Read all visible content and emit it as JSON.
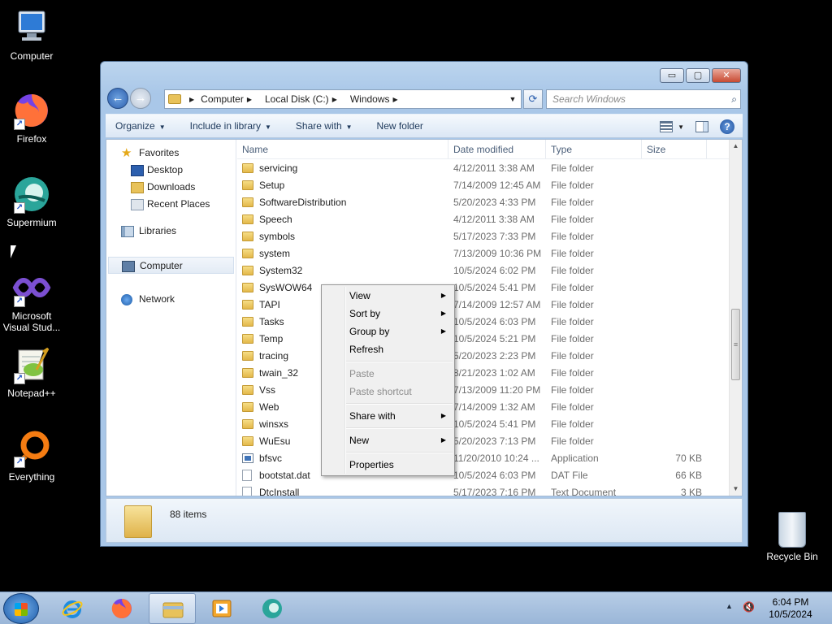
{
  "desktop": {
    "icons": [
      {
        "label": "Computer"
      },
      {
        "label": "Firefox"
      },
      {
        "label": "Supermium"
      },
      {
        "label": "Microsoft Visual Stud..."
      },
      {
        "label": "Notepad++"
      },
      {
        "label": "Everything"
      }
    ],
    "recycle_bin": "Recycle Bin"
  },
  "window": {
    "controls": {
      "minimize": "▭",
      "maximize": "▢",
      "close": "✕"
    },
    "address": {
      "crumbs": [
        "Computer",
        "Local Disk (C:)",
        "Windows"
      ]
    },
    "search_placeholder": "Search Windows",
    "commands": [
      "Organize",
      "Include in library",
      "Share with",
      "New folder"
    ],
    "nav": {
      "favorites": "Favorites",
      "favorites_items": [
        "Desktop",
        "Downloads",
        "Recent Places"
      ],
      "libraries": "Libraries",
      "computer": "Computer",
      "network": "Network"
    },
    "columns": {
      "name": "Name",
      "date": "Date modified",
      "type": "Type",
      "size": "Size"
    },
    "files": [
      {
        "name": "servicing",
        "date": "4/12/2011 3:38 AM",
        "type": "File folder",
        "size": "",
        "icon": "folder"
      },
      {
        "name": "Setup",
        "date": "7/14/2009 12:45 AM",
        "type": "File folder",
        "size": "",
        "icon": "folder"
      },
      {
        "name": "SoftwareDistribution",
        "date": "5/20/2023 4:33 PM",
        "type": "File folder",
        "size": "",
        "icon": "folder"
      },
      {
        "name": "Speech",
        "date": "4/12/2011 3:38 AM",
        "type": "File folder",
        "size": "",
        "icon": "folder"
      },
      {
        "name": "symbols",
        "date": "5/17/2023 7:33 PM",
        "type": "File folder",
        "size": "",
        "icon": "folder"
      },
      {
        "name": "system",
        "date": "7/13/2009 10:36 PM",
        "type": "File folder",
        "size": "",
        "icon": "folder"
      },
      {
        "name": "System32",
        "date": "10/5/2024 6:02 PM",
        "type": "File folder",
        "size": "",
        "icon": "folder"
      },
      {
        "name": "SysWOW64",
        "date": "10/5/2024 5:41 PM",
        "type": "File folder",
        "size": "",
        "icon": "folder"
      },
      {
        "name": "TAPI",
        "date": "7/14/2009 12:57 AM",
        "type": "File folder",
        "size": "",
        "icon": "folder"
      },
      {
        "name": "Tasks",
        "date": "10/5/2024 6:03 PM",
        "type": "File folder",
        "size": "",
        "icon": "folder"
      },
      {
        "name": "Temp",
        "date": "10/5/2024 5:21 PM",
        "type": "File folder",
        "size": "",
        "icon": "folder"
      },
      {
        "name": "tracing",
        "date": "5/20/2023 2:23 PM",
        "type": "File folder",
        "size": "",
        "icon": "folder"
      },
      {
        "name": "twain_32",
        "date": "8/21/2023 1:02 AM",
        "type": "File folder",
        "size": "",
        "icon": "folder"
      },
      {
        "name": "Vss",
        "date": "7/13/2009 11:20 PM",
        "type": "File folder",
        "size": "",
        "icon": "folder"
      },
      {
        "name": "Web",
        "date": "7/14/2009 1:32 AM",
        "type": "File folder",
        "size": "",
        "icon": "folder"
      },
      {
        "name": "winsxs",
        "date": "10/5/2024 5:41 PM",
        "type": "File folder",
        "size": "",
        "icon": "folder"
      },
      {
        "name": "WuEsu",
        "date": "5/20/2023 7:13 PM",
        "type": "File folder",
        "size": "",
        "icon": "folder"
      },
      {
        "name": "bfsvc",
        "date": "11/20/2010 10:24 ...",
        "type": "Application",
        "size": "70 KB",
        "icon": "app"
      },
      {
        "name": "bootstat.dat",
        "date": "10/5/2024 6:03 PM",
        "type": "DAT File",
        "size": "66 KB",
        "icon": "doc"
      },
      {
        "name": "DtcInstall",
        "date": "5/17/2023 7:16 PM",
        "type": "Text Document",
        "size": "3 KB",
        "icon": "doc"
      }
    ],
    "status": {
      "items_count": "88 items"
    }
  },
  "context_menu": {
    "items": [
      {
        "label": "View",
        "submenu": true,
        "disabled": false
      },
      {
        "label": "Sort by",
        "submenu": true,
        "disabled": false
      },
      {
        "label": "Group by",
        "submenu": true,
        "disabled": false
      },
      {
        "label": "Refresh",
        "submenu": false,
        "disabled": false
      },
      {
        "sep": true
      },
      {
        "label": "Paste",
        "submenu": false,
        "disabled": true
      },
      {
        "label": "Paste shortcut",
        "submenu": false,
        "disabled": true
      },
      {
        "sep": true
      },
      {
        "label": "Share with",
        "submenu": true,
        "disabled": false
      },
      {
        "sep": true
      },
      {
        "label": "New",
        "submenu": true,
        "disabled": false
      },
      {
        "sep": true
      },
      {
        "label": "Properties",
        "submenu": false,
        "disabled": false
      }
    ]
  },
  "taskbar": {
    "clock_time": "6:04 PM",
    "clock_date": "10/5/2024"
  }
}
